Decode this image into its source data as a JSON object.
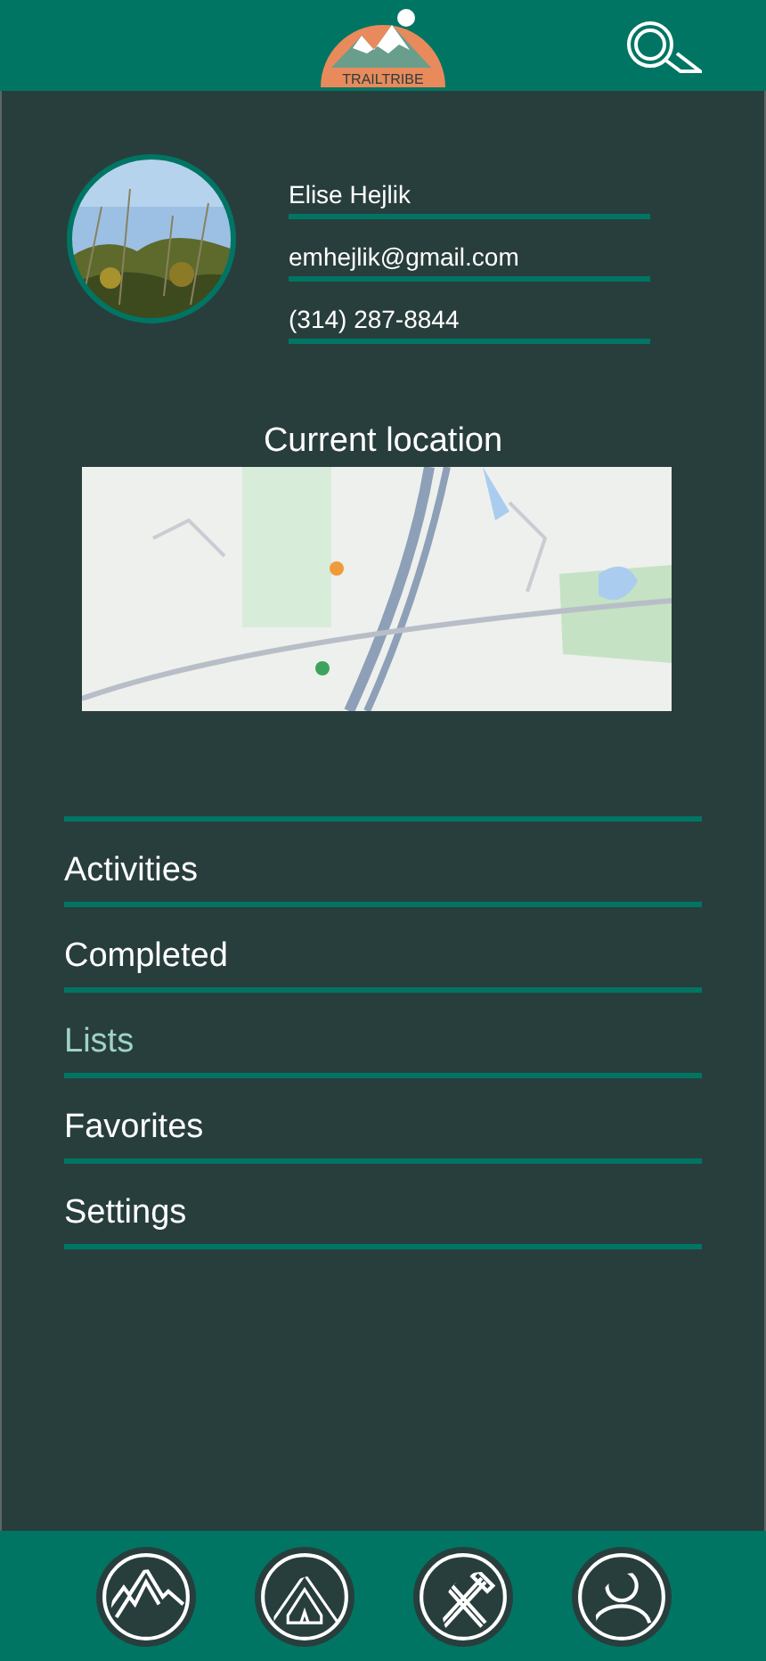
{
  "header": {
    "logo_text": "TRAILTRIBE"
  },
  "profile": {
    "fields": [
      {
        "value": "Elise Hejlik"
      },
      {
        "value": "emhejlik@gmail.com"
      },
      {
        "value": "(314) 287-8844"
      }
    ]
  },
  "location": {
    "title": "Current location"
  },
  "menu": [
    {
      "label": "Activities",
      "selected": false
    },
    {
      "label": "Completed",
      "selected": false
    },
    {
      "label": "Lists",
      "selected": true
    },
    {
      "label": "Favorites",
      "selected": false
    },
    {
      "label": "Settings",
      "selected": false
    }
  ],
  "bottom_nav": [
    {
      "kind": "mountains"
    },
    {
      "kind": "tent"
    },
    {
      "kind": "tools"
    },
    {
      "kind": "profile"
    }
  ]
}
